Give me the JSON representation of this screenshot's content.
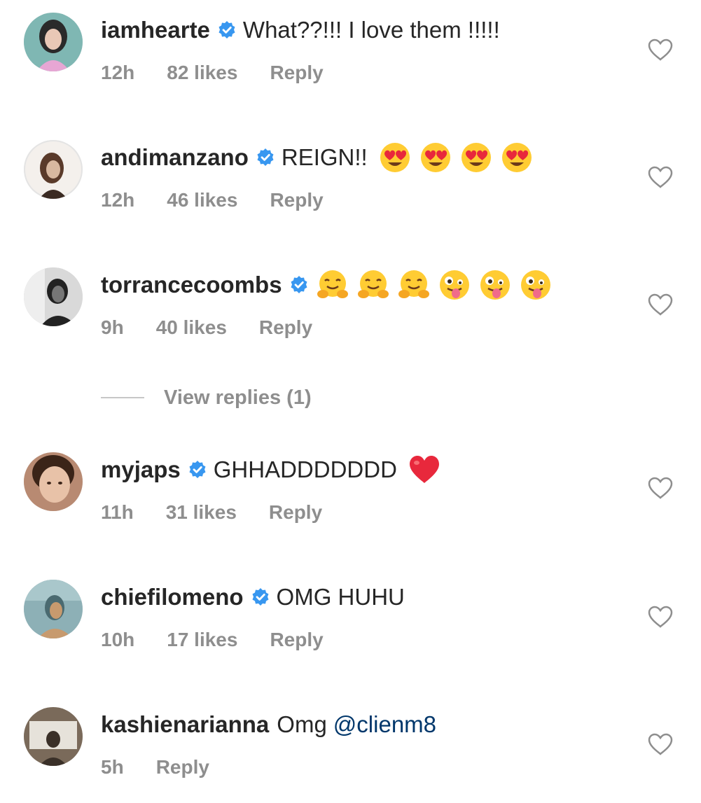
{
  "comments": [
    {
      "username": "iamhearte",
      "text": "What??!!! I love them !!!!!",
      "time": "12h",
      "likes": "82 likes",
      "reply": "Reply",
      "avatar_colors": [
        "#7fb7b3",
        "#2a2a2a",
        "#e7a6d4"
      ]
    },
    {
      "username": "andimanzano",
      "text": "REIGN!!",
      "emojis": [
        "heart-eyes-emoji",
        "heart-eyes-emoji",
        "heart-eyes-emoji",
        "heart-eyes-emoji"
      ],
      "time": "12h",
      "likes": "46 likes",
      "reply": "Reply",
      "avatar_colors": [
        "#f4f0ec",
        "#5a3a2a",
        "#d8b8a0"
      ]
    },
    {
      "username": "torrancecoombs",
      "text": "",
      "emojis": [
        "hugging-emoji",
        "hugging-emoji",
        "hugging-emoji",
        "zany-emoji",
        "zany-emoji",
        "zany-emoji"
      ],
      "time": "9h",
      "likes": "40 likes",
      "reply": "Reply",
      "avatar_colors": [
        "#d9d9d9",
        "#222222",
        "#777777"
      ]
    },
    {
      "username": "myjaps",
      "text": "GHHADDDDDDD",
      "emojis": [
        "red-heart-emoji"
      ],
      "time": "11h",
      "likes": "31 likes",
      "reply": "Reply",
      "avatar_colors": [
        "#b88a72",
        "#3b2418",
        "#e8c2a8"
      ]
    },
    {
      "username": "chiefilomeno",
      "text": "OMG HUHU",
      "time": "10h",
      "likes": "17 likes",
      "reply": "Reply",
      "avatar_colors": [
        "#8db0b6",
        "#c79a6e",
        "#4a6a70"
      ]
    },
    {
      "username": "kashienarianna",
      "text": "Omg",
      "mention": "@clienm8",
      "time": "5h",
      "reply": "Reply",
      "avatar_colors": [
        "#7a6a5a",
        "#e6e2da",
        "#3a3028"
      ]
    }
  ],
  "view_replies": "View replies (1)",
  "colors": {
    "verified": "#3897f0",
    "muted": "#8e8e8e",
    "mention": "#00376b"
  }
}
